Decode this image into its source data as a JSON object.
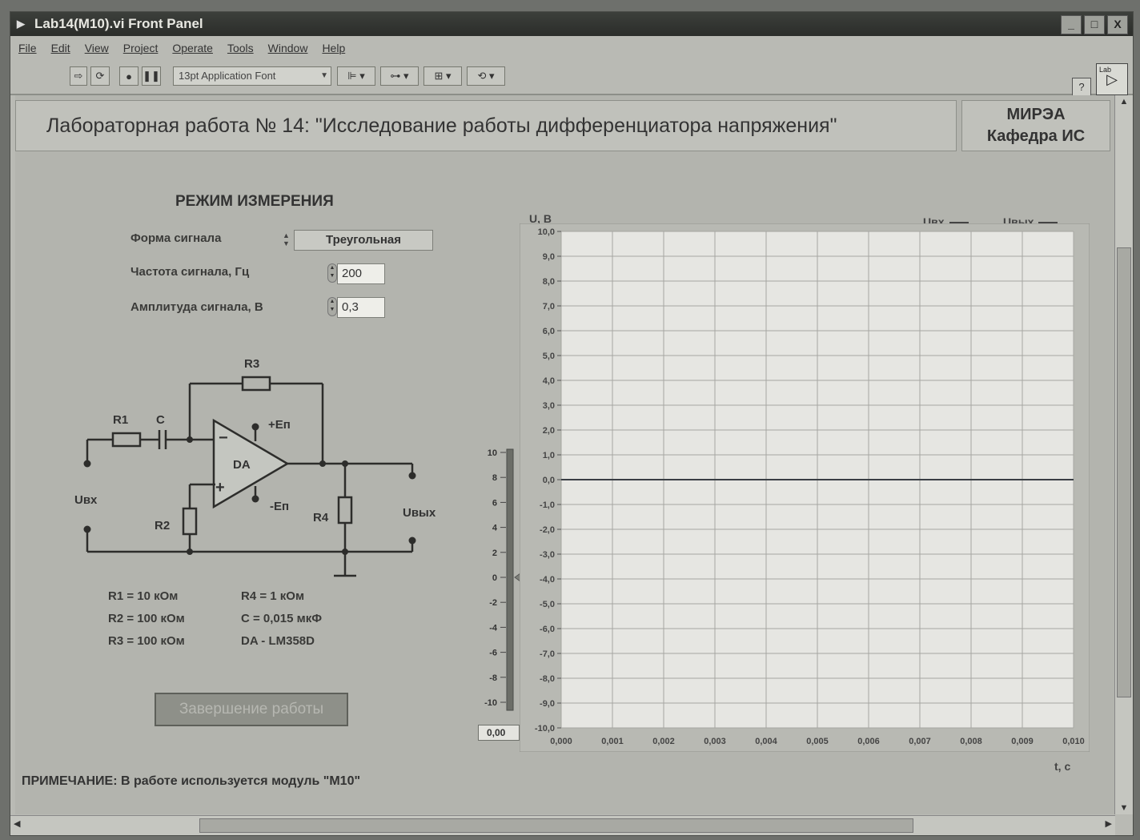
{
  "window": {
    "title": "Lab14(M10).vi Front Panel",
    "buttons": [
      "_",
      "□",
      "X"
    ]
  },
  "menu": [
    "File",
    "Edit",
    "View",
    "Project",
    "Operate",
    "Tools",
    "Window",
    "Help"
  ],
  "toolbar": {
    "font_selector": "13pt Application Font",
    "help_label": "?",
    "lv_icon_label": "Lab"
  },
  "header": {
    "title": "Лабораторная работа № 14: \"Исследование работы дифференциатора напряжения\"",
    "org_line1": "МИРЭА",
    "org_line2": "Кафедра ИС"
  },
  "mode": {
    "title": "РЕЖИМ ИЗМЕРЕНИЯ",
    "waveform_label": "Форма сигнала",
    "waveform_value": "Треугольная",
    "freq_label": "Частота сигнала, Гц",
    "freq_value": "200",
    "amp_label": "Амплитуда сигнала, В",
    "amp_value": "0,3"
  },
  "circuit": {
    "labels": {
      "R1": "R1",
      "C": "C",
      "R3": "R3",
      "R2": "R2",
      "R4": "R4",
      "DA": "DA",
      "minus": "−",
      "plus": "+",
      "plus_en": "+Еп",
      "minus_en": "-Еп",
      "u_in": "Uвх",
      "u_out": "Uвых"
    },
    "params_left": [
      "R1 = 10 кОм",
      "R2 = 100 кОм",
      "R3 = 100 кОм"
    ],
    "params_right": [
      "R4 = 1 кОм",
      "C  =  0,015 мкФ",
      "DA - LM358D"
    ]
  },
  "stop_button": "Завершение работы",
  "note": "ПРИМЕЧАНИЕ: В работе используется модуль \"М10\"",
  "slider": {
    "ticks": [
      "10",
      "8",
      "6",
      "4",
      "2",
      "0",
      "-2",
      "-4",
      "-6",
      "-8",
      "-10"
    ],
    "value": 0,
    "value_text": "0,00"
  },
  "chart_data": {
    "type": "line",
    "ylabel": "U, В",
    "xlabel": "t, с",
    "ylim": [
      -10,
      10
    ],
    "xlim": [
      0,
      0.01
    ],
    "y_ticks": [
      "10,0",
      "9,0",
      "8,0",
      "7,0",
      "6,0",
      "5,0",
      "4,0",
      "3,0",
      "2,0",
      "1,0",
      "0,0",
      "-1,0",
      "-2,0",
      "-3,0",
      "-4,0",
      "-5,0",
      "-6,0",
      "-7,0",
      "-8,0",
      "-9,0",
      "-10,0"
    ],
    "x_ticks": [
      "0,000",
      "0,001",
      "0,002",
      "0,003",
      "0,004",
      "0,005",
      "0,006",
      "0,007",
      "0,008",
      "0,009",
      "0,010"
    ],
    "grid": true,
    "legend": [
      "Uвх",
      "Uвых"
    ],
    "legend_position": "top-right",
    "series": [
      {
        "name": "Uвх",
        "x": [
          0,
          0.01
        ],
        "y": [
          0,
          0
        ]
      },
      {
        "name": "Uвых",
        "x": [
          0,
          0.01
        ],
        "y": [
          0,
          0
        ]
      }
    ],
    "colors": {
      "plot_bg": "#e6e6e2",
      "grid": "#a6a6a2",
      "line": "#3a3e44"
    }
  }
}
